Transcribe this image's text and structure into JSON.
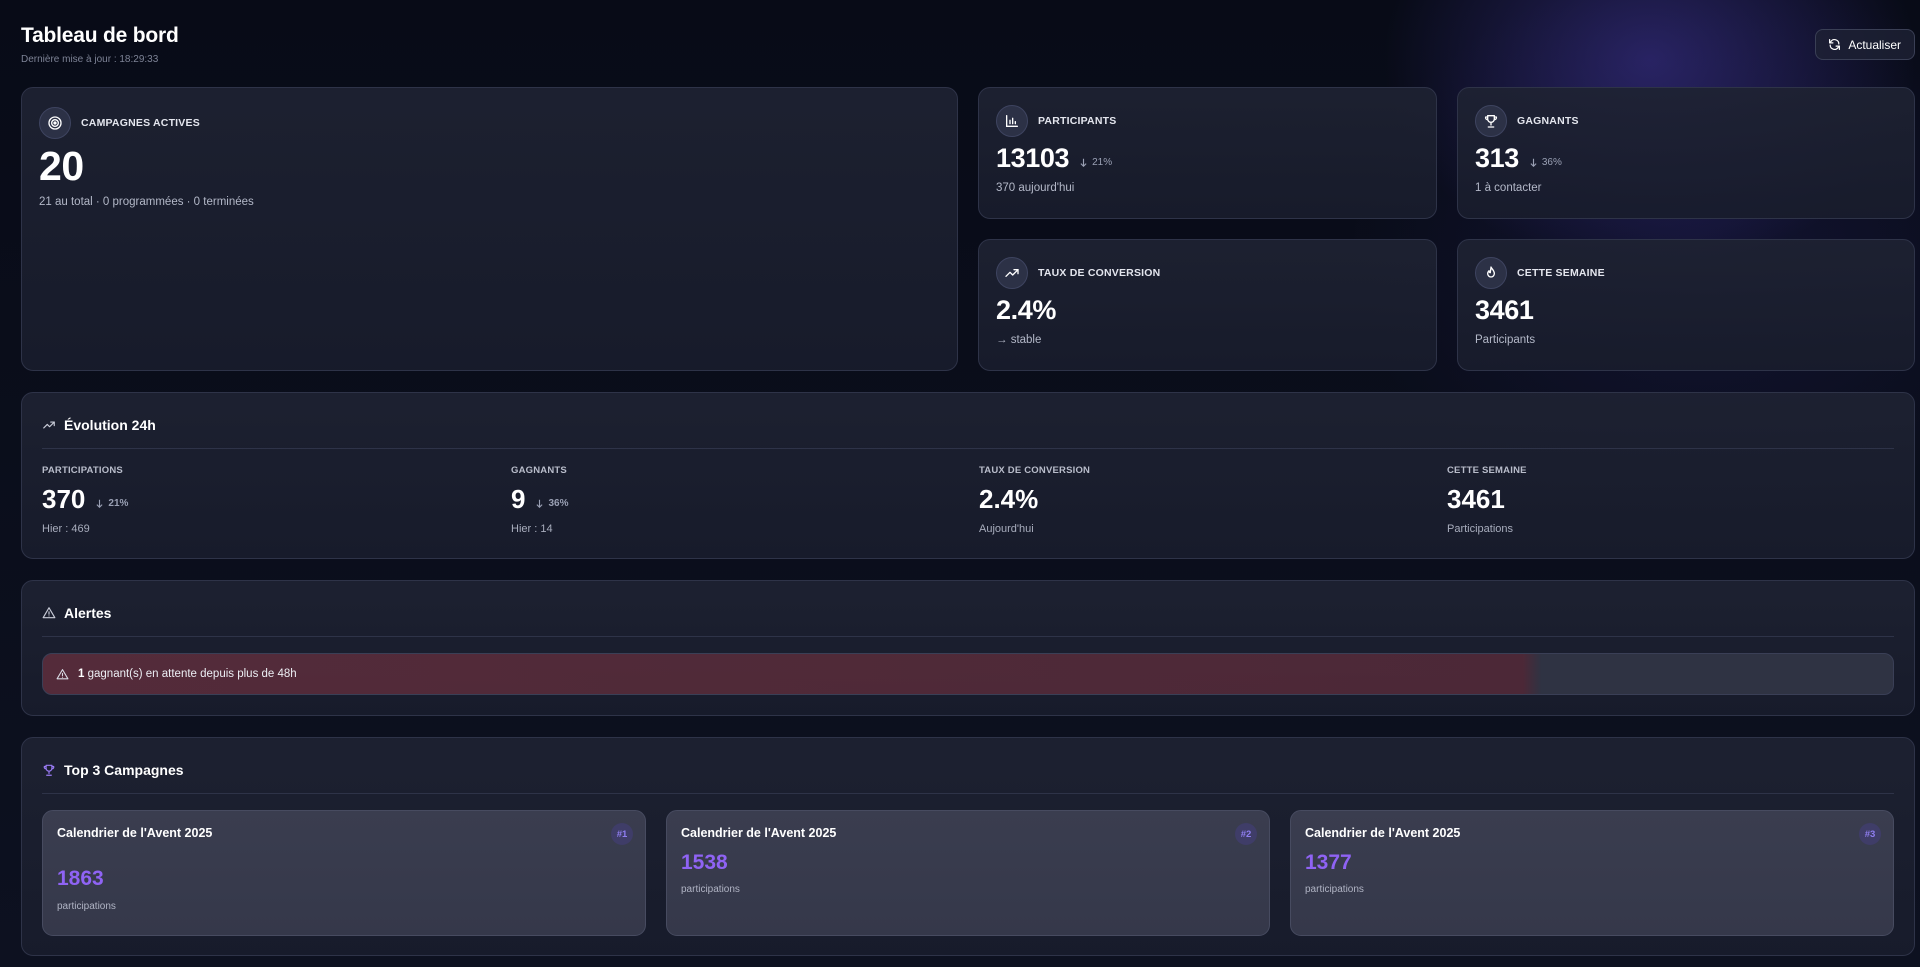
{
  "header": {
    "title": "Tableau de bord",
    "subtitle": "Dernière mise à jour : 18:29:33",
    "refresh_label": "Actualiser"
  },
  "stats": {
    "active_campaigns": {
      "label": "CAMPAGNES ACTIVES",
      "value": "20",
      "sub": "21 au total · 0 programmées · 0 terminées",
      "icon": "target-icon"
    },
    "participants": {
      "label": "PARTICIPANTS",
      "value": "13103",
      "delta": "21%",
      "sub": "370 aujourd'hui",
      "icon": "bar-chart-icon"
    },
    "winners": {
      "label": "GAGNANTS",
      "value": "313",
      "delta": "36%",
      "sub": "1 à contacter",
      "icon": "trophy-icon"
    },
    "conversion": {
      "label": "TAUX DE CONVERSION",
      "value": "2.4%",
      "sub": "→ stable",
      "icon": "trending-up-icon"
    },
    "week": {
      "label": "CETTE SEMAINE",
      "value": "3461",
      "sub": "Participants",
      "icon": "flame-icon"
    }
  },
  "evolution": {
    "title": "Évolution 24h",
    "columns": [
      {
        "label": "PARTICIPATIONS",
        "value": "370",
        "delta": "21%",
        "sub": "Hier : 469"
      },
      {
        "label": "GAGNANTS",
        "value": "9",
        "delta": "36%",
        "sub": "Hier : 14"
      },
      {
        "label": "TAUX DE CONVERSION",
        "value": "2.4%",
        "delta": "",
        "sub": "Aujourd'hui"
      },
      {
        "label": "CETTE SEMAINE",
        "value": "3461",
        "delta": "",
        "sub": "Participations"
      }
    ]
  },
  "alerts": {
    "title": "Alertes",
    "items": [
      {
        "count": "1",
        "text": "gagnant(s) en attente depuis plus de 48h"
      }
    ]
  },
  "top_campaigns": {
    "title": "Top 3 Campagnes",
    "items": [
      {
        "name": "Calendrier de l'Avent 2025",
        "rank": "#1",
        "value": "1863",
        "sub": "participations"
      },
      {
        "name": "Calendrier de l'Avent 2025",
        "rank": "#2",
        "value": "1538",
        "sub": "participations"
      },
      {
        "name": "Calendrier de l'Avent 2025",
        "rank": "#3",
        "value": "1377",
        "sub": "participations"
      }
    ]
  },
  "colors": {
    "accent": "#8f63f4",
    "background": "#0a0d1a",
    "card": "#1c2032",
    "alert": "#6e3040"
  }
}
